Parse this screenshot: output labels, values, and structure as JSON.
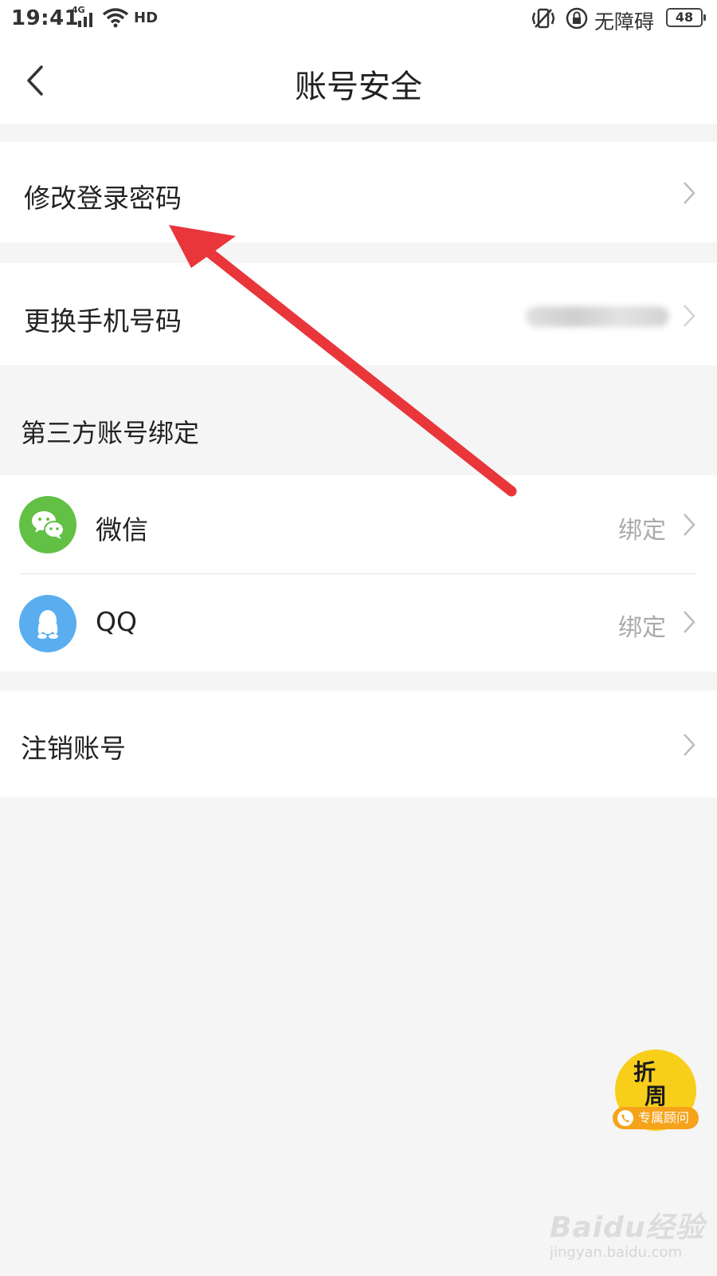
{
  "status_bar": {
    "time": "19:41",
    "network": "4G",
    "hd": "HD",
    "accessibility": "无障碍",
    "battery": "48"
  },
  "nav": {
    "title": "账号安全"
  },
  "rows": {
    "change_password": "修改登录密码",
    "change_phone": "更换手机号码",
    "cancel_account": "注销账号"
  },
  "third_party": {
    "section_title": "第三方账号绑定",
    "items": [
      {
        "label": "微信",
        "status": "绑定",
        "icon": "wechat-icon"
      },
      {
        "label": "QQ",
        "status": "绑定",
        "icon": "qq-icon"
      }
    ]
  },
  "fab": {
    "brand": "折　\n周",
    "pill": "专属顾问"
  },
  "watermark": {
    "text": "Baidu经验",
    "url": "jingyan.baidu.com"
  },
  "colors": {
    "wechat": "#62c045",
    "qq": "#5aaef0",
    "fab": "#f7cf1b",
    "annotation_arrow": "#e8363a"
  }
}
